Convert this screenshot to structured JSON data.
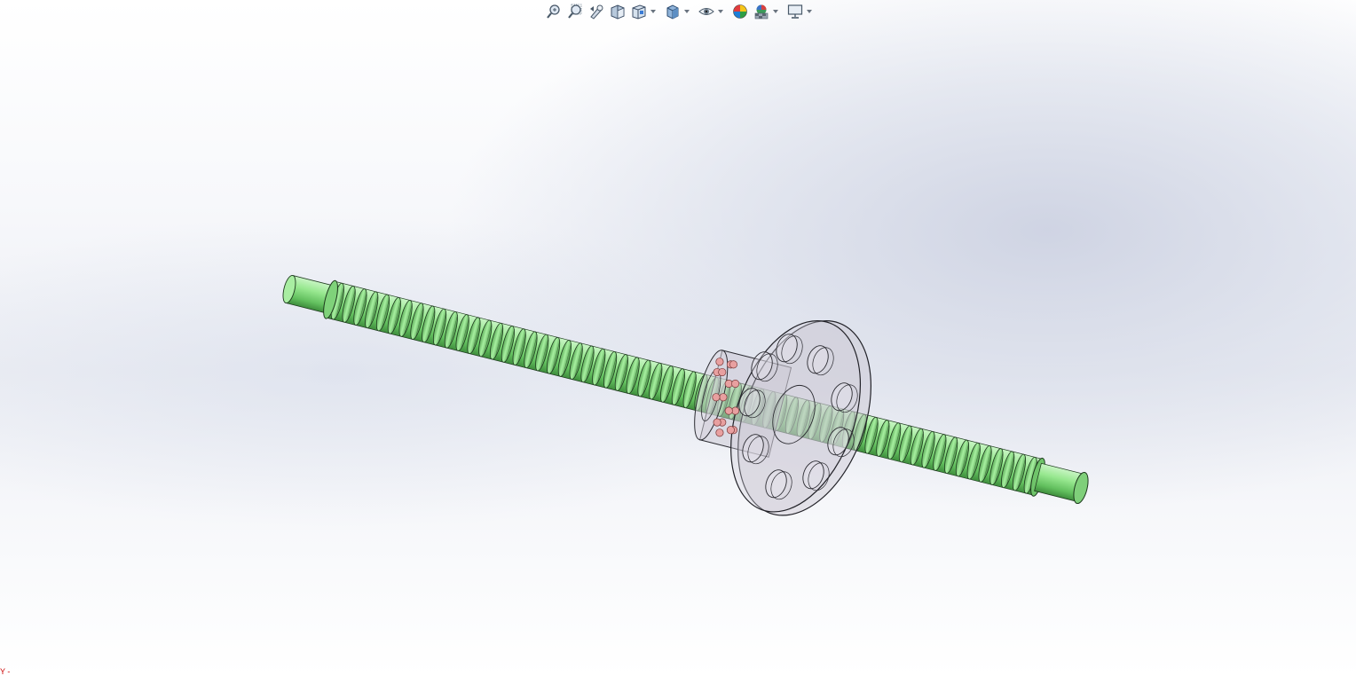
{
  "toolbar": {
    "buttons": [
      {
        "name": "zoom-to-fit-icon",
        "has_dropdown": false
      },
      {
        "name": "zoom-to-area-icon",
        "has_dropdown": false
      },
      {
        "name": "previous-view-icon",
        "has_dropdown": false
      },
      {
        "name": "section-view-icon",
        "has_dropdown": false
      },
      {
        "name": "view-orientation-icon",
        "has_dropdown": true
      },
      {
        "name": "display-style-icon",
        "has_dropdown": true
      },
      {
        "name": "hide-show-items-icon",
        "has_dropdown": true
      },
      {
        "name": "edit-appearance-icon",
        "has_dropdown": false
      },
      {
        "name": "apply-scene-icon",
        "has_dropdown": true
      },
      {
        "name": "view-settings-icon",
        "has_dropdown": true
      }
    ]
  },
  "model": {
    "screw_color": "#90ee90",
    "screw_edge_color": "#1e3a1e",
    "nut_color": "rgba(200,196,208,0.45)",
    "ball_color": "#e8a0a0"
  },
  "triad": {
    "label": "Y -"
  }
}
